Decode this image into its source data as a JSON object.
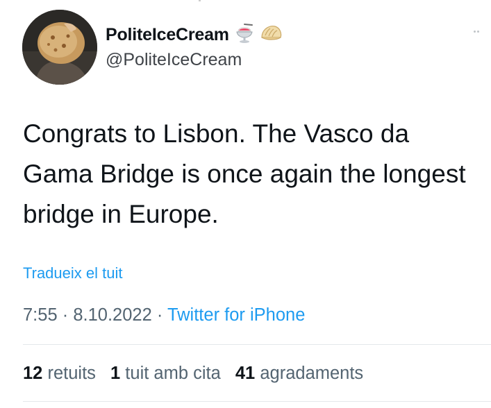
{
  "author": {
    "display_name": "PoliteIceCream",
    "handle": "@PoliteIceCream",
    "badge_icons": [
      "shaved-ice-icon",
      "dumpling-icon"
    ]
  },
  "tweet": {
    "text": "Congrats to Lisbon. The Vasco da Gama Bridge is once again the longest bridge in Europe.",
    "translate_label": "Tradueix el tuit",
    "time": "7:55",
    "date": "8.10.2022",
    "separator": " · ",
    "source": "Twitter for iPhone"
  },
  "stats": {
    "retweets_count": "12",
    "retweets_label": "retuits",
    "quotes_count": "1",
    "quotes_label": "tuit amb cita",
    "likes_count": "41",
    "likes_label": "agradaments"
  },
  "colors": {
    "link": "#1d9bf0",
    "text": "#0f1419",
    "secondary": "#536471"
  }
}
